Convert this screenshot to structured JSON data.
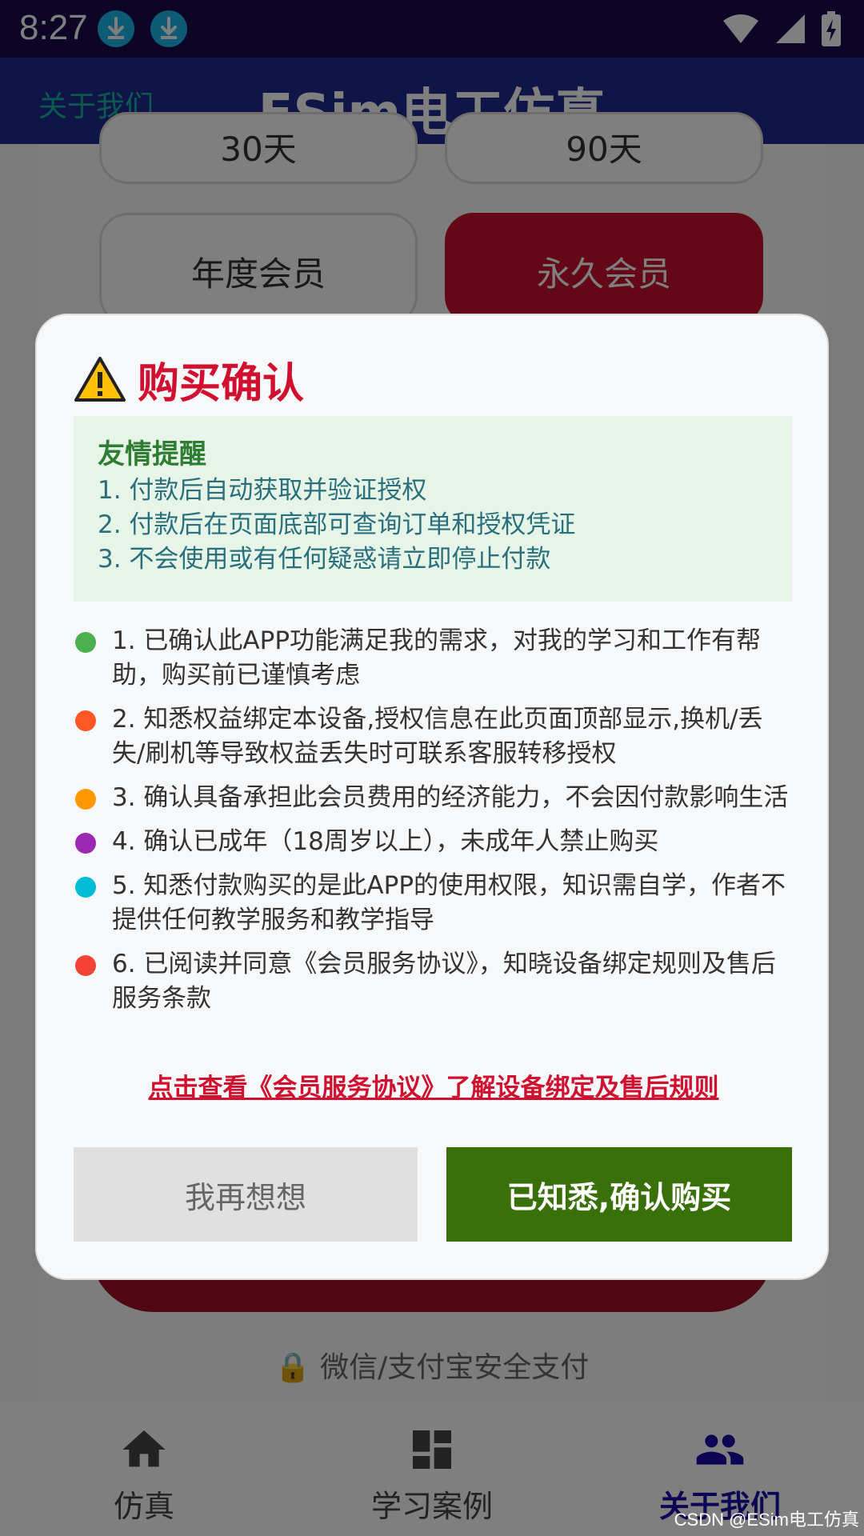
{
  "status_bar": {
    "time": "8:27"
  },
  "app_bar": {
    "about_link": "关于我们",
    "title": "ESim电工仿真"
  },
  "background": {
    "plan_prices": [
      "30天",
      "90天"
    ],
    "plans": [
      {
        "label": "年度会员",
        "selected": false
      },
      {
        "label": "永久会员",
        "selected": true
      }
    ],
    "secure_text": "微信/支付宝安全支付"
  },
  "bottom_nav": [
    {
      "label": "仿真",
      "icon": "home-icon",
      "active": false
    },
    {
      "label": "学习案例",
      "icon": "dashboard-icon",
      "active": false
    },
    {
      "label": "关于我们",
      "icon": "people-icon",
      "active": true
    }
  ],
  "dialog": {
    "title": "购买确认",
    "reminder": {
      "title": "友情提醒",
      "lines": [
        "1. 付款后自动获取并验证授权",
        "2. 付款后在页面底部可查询订单和授权凭证",
        "3. 不会使用或有任何疑惑请立即停止付款"
      ]
    },
    "terms": [
      {
        "text": "1. 已确认此APP功能满足我的需求，对我的学习和工作有帮助，购买前已谨慎考虑",
        "color": "#4caf50"
      },
      {
        "text": "2. 知悉权益绑定本设备,授权信息在此页面顶部显示,换机/丢失/刷机等导致权益丢失时可联系客服转移授权",
        "color": "#ff5722"
      },
      {
        "text": "3. 确认具备承担此会员费用的经济能力，不会因付款影响生活",
        "color": "#ff9800"
      },
      {
        "text": "4. 确认已成年（18周岁以上），未成年人禁止购买",
        "color": "#9c27b0"
      },
      {
        "text": "5. 知悉付款购买的是此APP的使用权限，知识需自学，作者不提供任何教学服务和教学指导",
        "color": "#00bcd4"
      },
      {
        "text": "6. 已阅读并同意《会员服务协议》，知晓设备绑定规则及售后服务条款",
        "color": "#f44336"
      }
    ],
    "agreement_link": "点击查看《会员服务协议》了解设备绑定及售后规则",
    "cancel_label": "我再想想",
    "confirm_label": "已知悉,确认购买"
  },
  "watermark": "CSDN @ESim电工仿真",
  "colors": {
    "accent_red": "#d0102e",
    "confirm_green": "#3a7009",
    "nav_active": "#1b0aa8"
  }
}
